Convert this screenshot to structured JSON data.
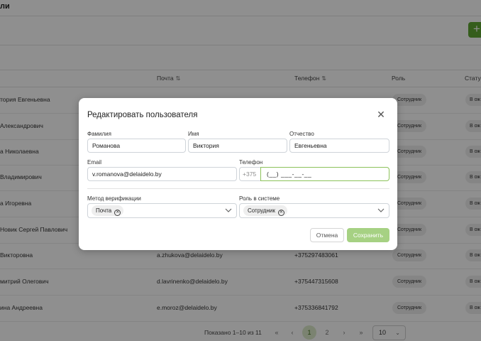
{
  "header": {
    "title": "ли"
  },
  "table": {
    "headers": {
      "email": "Почта",
      "phone": "Телефон",
      "role": "Роль",
      "status": "Стату"
    },
    "rows": [
      {
        "name": "тория Евгеньевна",
        "email": "",
        "phone": "",
        "role": "Сотрудник",
        "status": "В ож"
      },
      {
        "name": "Александрович",
        "email": "",
        "phone": "",
        "role": "Сотрудник",
        "status": "В ож"
      },
      {
        "name": "а Николаевна",
        "email": "",
        "phone": "",
        "role": "Сотрудник",
        "status": "В ож"
      },
      {
        "name": "Владимирович",
        "email": "",
        "phone": "",
        "role": "Сотрудник",
        "status": "В ож"
      },
      {
        "name": "а Игоревна",
        "email": "",
        "phone": "",
        "role": "Сотрудник",
        "status": "В ож"
      },
      {
        "name": "Новик Сергей Павлович",
        "email": "",
        "phone": "",
        "role": "Сотрудник",
        "status": "В ож"
      },
      {
        "name": "Викторовна",
        "email": "a.zhukova@delaidelo.by",
        "phone": "+375297483061",
        "role": "Сотрудник",
        "status": "В ож"
      },
      {
        "name": "митрий Олегович",
        "email": "d.lavrinenko@delaidelo.by",
        "phone": "+375447315608",
        "role": "Сотрудник",
        "status": "В ож"
      },
      {
        "name": "ина Андреевна",
        "email": "e.moroz@delaidelo.by",
        "phone": "+375336841792",
        "role": "Сотрудник",
        "status": "В ож"
      }
    ]
  },
  "pagination": {
    "summary": "Показано 1–10 из 11",
    "first": "«",
    "prev": "‹",
    "pages": [
      "1",
      "2"
    ],
    "current_page": "1",
    "next": "›",
    "last": "»",
    "page_size": "10"
  },
  "modal": {
    "title": "Редактировать пользователя",
    "close_glyph": "✕",
    "fields": {
      "last_name": {
        "label": "Фамилия",
        "value": "Романова"
      },
      "first_name": {
        "label": "Имя",
        "value": "Виктория"
      },
      "middle_name": {
        "label": "Отчество",
        "value": "Евгеньевна"
      },
      "email": {
        "label": "Email",
        "value": "v.romanova@delaidelo.by"
      },
      "phone": {
        "label": "Телефон",
        "prefix": "+375",
        "value": "(__) ___-__-__"
      },
      "verification": {
        "label": "Метод верификации",
        "tag": "Почта"
      },
      "role": {
        "label": "Роль в системе",
        "tag": "Сотрудник"
      }
    },
    "buttons": {
      "cancel": "Отмена",
      "save": "Сохранить"
    }
  },
  "colors": {
    "accent": "#5fa632",
    "save_disabled": "#a6d183",
    "phone_focus_border": "#8cc25a"
  },
  "icons": {
    "add": "plus-icon",
    "close": "close-icon",
    "chevron": "chevron-down-icon",
    "tag_remove": "circle-x-icon",
    "sort": "sort-icon"
  }
}
